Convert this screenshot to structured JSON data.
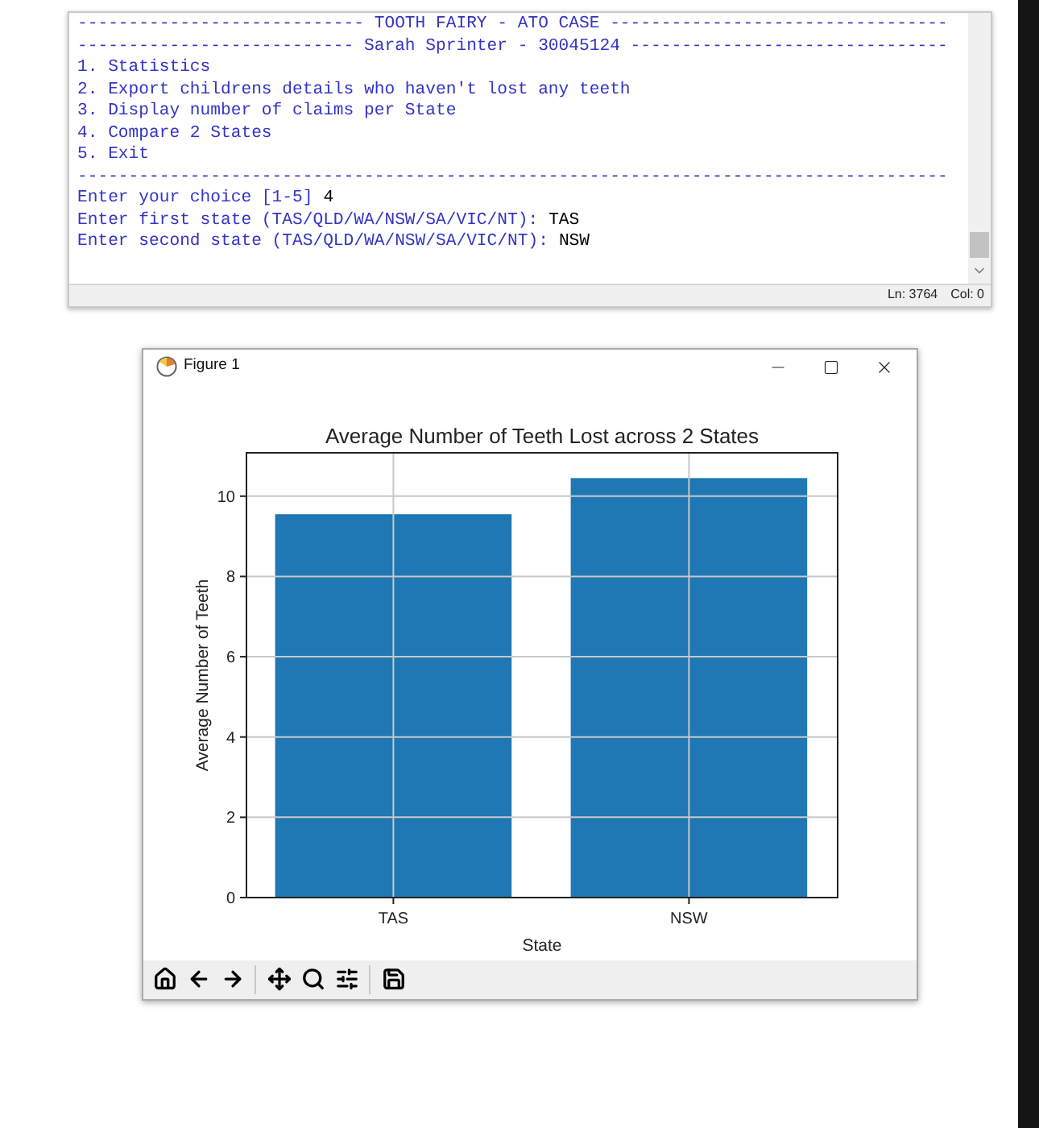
{
  "console": {
    "lines": [
      {
        "kind": "header",
        "text": "---------------------------- TOOTH FAIRY - ATO CASE ---------------------------------"
      },
      {
        "kind": "header",
        "text": "--------------------------- Sarah Sprinter - 30045124 -------------------------------"
      },
      {
        "kind": "menu",
        "text": "1. Statistics"
      },
      {
        "kind": "menu",
        "text": "2. Export childrens details who haven't lost any teeth"
      },
      {
        "kind": "menu",
        "text": "3. Display number of claims per State"
      },
      {
        "kind": "menu",
        "text": "4. Compare 2 States"
      },
      {
        "kind": "menu",
        "text": "5. Exit"
      },
      {
        "kind": "header",
        "text": "-------------------------------------------------------------------------------------"
      },
      {
        "kind": "input",
        "text": "Enter your choice [1-5]",
        "answer": "4"
      },
      {
        "kind": "input",
        "text": "Enter first state (TAS/QLD/WA/NSW/SA/VIC/NT):",
        "answer": "TAS"
      },
      {
        "kind": "input",
        "text": "Enter second state (TAS/QLD/WA/NSW/SA/VIC/NT):",
        "answer": "NSW"
      }
    ],
    "status_bar": {
      "line": "Ln: 3764",
      "column": "Col: 0"
    }
  },
  "figure": {
    "title": "Figure 1",
    "chart_data": {
      "type": "bar",
      "title": "Average Number of Teeth Lost across 2 States",
      "xlabel": "State",
      "ylabel": "Average Number of Teeth",
      "categories": [
        "TAS",
        "NSW"
      ],
      "series": [
        {
          "color": "#1f77b4",
          "values": [
            9.55,
            10.45
          ]
        }
      ],
      "grid": true,
      "ylim": [
        0,
        11.08
      ],
      "yticks": [
        0,
        2,
        4,
        6,
        8,
        10
      ]
    },
    "toolbar": [
      {
        "kind": "home"
      },
      {
        "kind": "back"
      },
      {
        "kind": "forward"
      },
      {
        "kind": "sep"
      },
      {
        "kind": "pan"
      },
      {
        "kind": "zoom"
      },
      {
        "kind": "configure"
      },
      {
        "kind": "sep"
      },
      {
        "kind": "save"
      }
    ]
  }
}
